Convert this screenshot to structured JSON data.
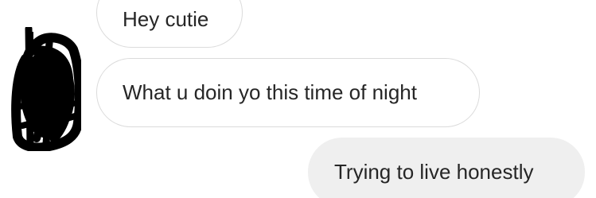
{
  "conversation": {
    "messages": [
      {
        "direction": "incoming",
        "text": "Hey cutie"
      },
      {
        "direction": "incoming",
        "text": "What u doin yo this time of night"
      },
      {
        "direction": "outgoing",
        "text": "Trying to live honestly"
      }
    ],
    "avatar": {
      "state": "scribbled-out"
    }
  },
  "colors": {
    "incoming_bubble_border": "#dbdbdb",
    "outgoing_bubble_bg": "#efefef",
    "text": "#262626",
    "redaction": "#000000"
  }
}
